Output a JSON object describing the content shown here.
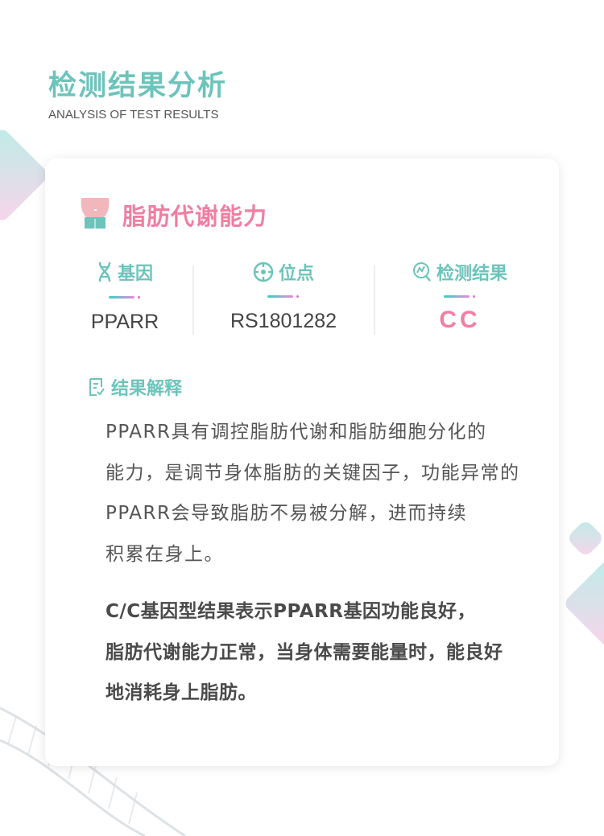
{
  "header": {
    "title": "检测结果分析",
    "subtitle": "ANALYSIS OF TEST RESULTS"
  },
  "card": {
    "title": "脂肪代谢能力",
    "title_icon": "belly-icon",
    "columns": [
      {
        "label": "基因",
        "icon": "dna-icon",
        "value": "PPARR"
      },
      {
        "label": "位点",
        "icon": "target-icon",
        "value": "RS1801282"
      },
      {
        "label": "检测结果",
        "icon": "chart-search-icon",
        "value": "CC"
      }
    ],
    "section": {
      "label": "结果解释",
      "icon": "document-check-icon"
    },
    "paragraph1": [
      "PPARR具有调控脂肪代谢和脂肪细胞分化的",
      "能力，是调节身体脂肪的关键因子，功能异常的",
      "PPARR会导致脂肪不易被分解，进而持续",
      "积累在身上。"
    ],
    "paragraph2": [
      "C/C基因型结果表示PPARR基因功能良好，",
      "脂肪代谢能力正常，当身体需要能量时，能良好",
      "地消耗身上脂肪。"
    ]
  },
  "colors": {
    "teal": "#6cc4bb",
    "pink": "#f07fa2",
    "text": "#555555"
  }
}
